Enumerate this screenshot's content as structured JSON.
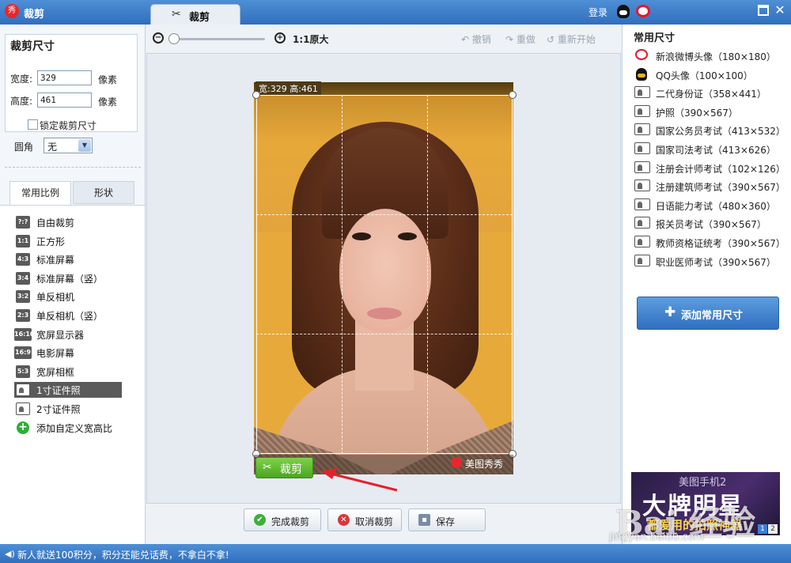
{
  "app": {
    "title": "裁剪",
    "logo_char": "秀",
    "tab_label": "裁剪",
    "login": "登录"
  },
  "left": {
    "size_title": "裁剪尺寸",
    "width_label": "宽度:",
    "width_value": "329",
    "height_label": "高度:",
    "height_value": "461",
    "unit": "像素",
    "lock_label": "锁定裁剪尺寸",
    "lock_checked": false,
    "round_label": "圆角",
    "round_value": "无",
    "tabs": [
      "常用比例",
      "形状"
    ],
    "ratios": [
      {
        "icon": "?:?",
        "label": "自由裁剪"
      },
      {
        "icon": "1:1",
        "label": "正方形"
      },
      {
        "icon": "4:3",
        "label": "标准屏幕"
      },
      {
        "icon": "3:4",
        "label": "标准屏幕（竖）"
      },
      {
        "icon": "3:2",
        "label": "单反相机"
      },
      {
        "icon": "2:3",
        "label": "单反相机（竖）"
      },
      {
        "icon": "16:10",
        "label": "宽屏显示器"
      },
      {
        "icon": "16:9",
        "label": "电影屏幕"
      },
      {
        "icon": "5:3",
        "label": "宽屏相框"
      },
      {
        "icon": "id-photo-icon",
        "label": "1寸证件照",
        "selected": true
      },
      {
        "icon": "id-photo-icon",
        "label": "2寸证件照"
      },
      {
        "icon": "plus-icon",
        "label": "添加自定义宽高比"
      }
    ]
  },
  "toolbar": {
    "zoom_text": "1:1原大",
    "undo": "撤销",
    "redo": "重做",
    "restart": "重新开始"
  },
  "canvas": {
    "dim_label": "宽:329 高:461",
    "crop_button": "裁剪",
    "watermark": "美图秀秀"
  },
  "actions": {
    "done": "完成裁剪",
    "cancel": "取消裁剪",
    "save": "保存"
  },
  "right": {
    "title": "常用尺寸",
    "presets": [
      {
        "icon": "weibo-icon",
        "label": "新浪微博头像（180×180）"
      },
      {
        "icon": "qq-icon",
        "label": "QQ头像（100×100）"
      },
      {
        "icon": "id-photo-icon",
        "label": "二代身份证（358×441）"
      },
      {
        "icon": "id-photo-icon",
        "label": "护照（390×567）"
      },
      {
        "icon": "id-photo-icon",
        "label": "国家公务员考试（413×532）"
      },
      {
        "icon": "id-photo-icon",
        "label": "国家司法考试（413×626）"
      },
      {
        "icon": "id-photo-icon",
        "label": "注册会计师考试（102×126）"
      },
      {
        "icon": "id-photo-icon",
        "label": "注册建筑师考试（390×567）"
      },
      {
        "icon": "id-photo-icon",
        "label": "日语能力考试（480×360）"
      },
      {
        "icon": "id-photo-icon",
        "label": "报关员考试（390×567）"
      },
      {
        "icon": "id-photo-icon",
        "label": "教师资格证统考（390×567）"
      },
      {
        "icon": "id-photo-icon",
        "label": "职业医师考试（390×567）"
      }
    ],
    "add_button": "添加常用尺寸",
    "ad": {
      "top": "美图手机2",
      "big": "大牌明星",
      "sub": "都爱用的拍照神器",
      "page1": "1",
      "page2": "2"
    }
  },
  "watermarks": {
    "baidu": "Bai 经验",
    "url": "jingyan.baidu.com"
  },
  "status": "新人就送100积分，积分还能兑话费，不拿白不拿!",
  "colors": {
    "titlebar": "#2f6fbd",
    "crop_green": "#4aa61f",
    "accent_blue": "#3a7fd9"
  }
}
